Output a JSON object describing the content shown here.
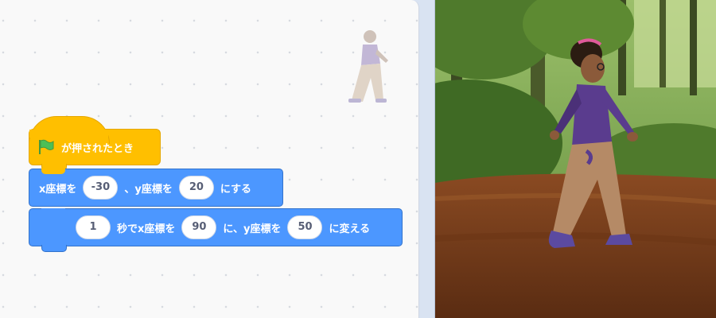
{
  "workspace": {
    "hat_block": {
      "label": "が押されたとき",
      "icon": "green-flag-icon"
    },
    "set_xy_block": {
      "prefix": "x座標を",
      "x_value": "-30",
      "middle": "、y座標を",
      "y_value": "20",
      "suffix": "にする"
    },
    "glide_block": {
      "seconds": "1",
      "part1": "秒でx座標を",
      "x_value": "90",
      "part2": "に、y座標を",
      "y_value": "50",
      "suffix": "に変える"
    }
  },
  "colors": {
    "events": "#ffbf00",
    "motion": "#4c97ff",
    "workspace_bg": "#f9f9f9"
  }
}
